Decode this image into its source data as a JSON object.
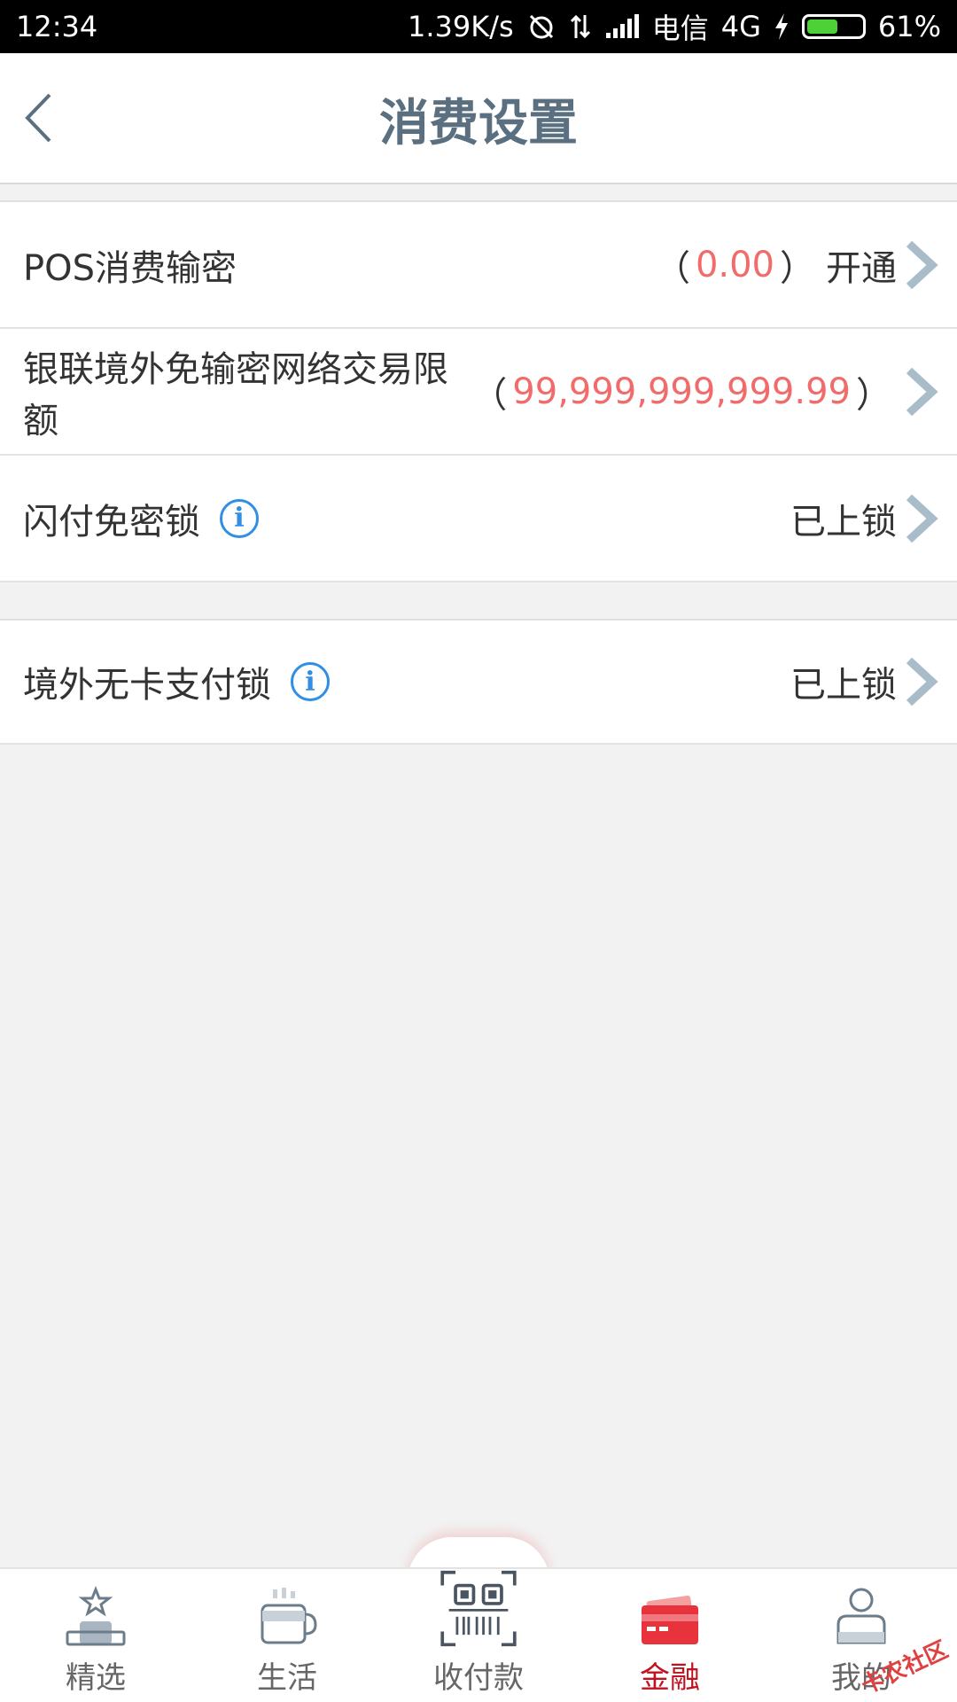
{
  "status_bar": {
    "time": "12:34",
    "net_speed": "1.39K/s",
    "carrier": "电信",
    "network": "4G",
    "battery_percent": "61%",
    "battery_level": 0.61
  },
  "header": {
    "title": "消费设置"
  },
  "rows": [
    {
      "label": "POS消费输密",
      "paren_open": "（",
      "amount": "0.00",
      "paren_close": "）",
      "status": "开通"
    },
    {
      "label": "银联境外免输密网络交易限额",
      "paren_open": "（",
      "amount": "99,999,999,999.99",
      "paren_close": "）"
    },
    {
      "label": "闪付免密锁",
      "info": "i",
      "status": "已上锁"
    },
    {
      "label": "境外无卡支付锁",
      "info": "i",
      "status": "已上锁"
    }
  ],
  "tabs": [
    {
      "label": "精选",
      "icon": "star-podium-icon"
    },
    {
      "label": "生活",
      "icon": "cup-icon"
    },
    {
      "label": "收付款",
      "icon": "scan-qr-icon"
    },
    {
      "label": "金融",
      "icon": "card-icon",
      "active": true
    },
    {
      "label": "我的",
      "icon": "user-icon"
    }
  ],
  "watermark": "卡农社区",
  "colors": {
    "title": "#5a6f80",
    "amount": "#f26b6b",
    "info": "#2f8fe5",
    "active_tab": "#c1121f",
    "chevron": "#a9bcc9"
  }
}
